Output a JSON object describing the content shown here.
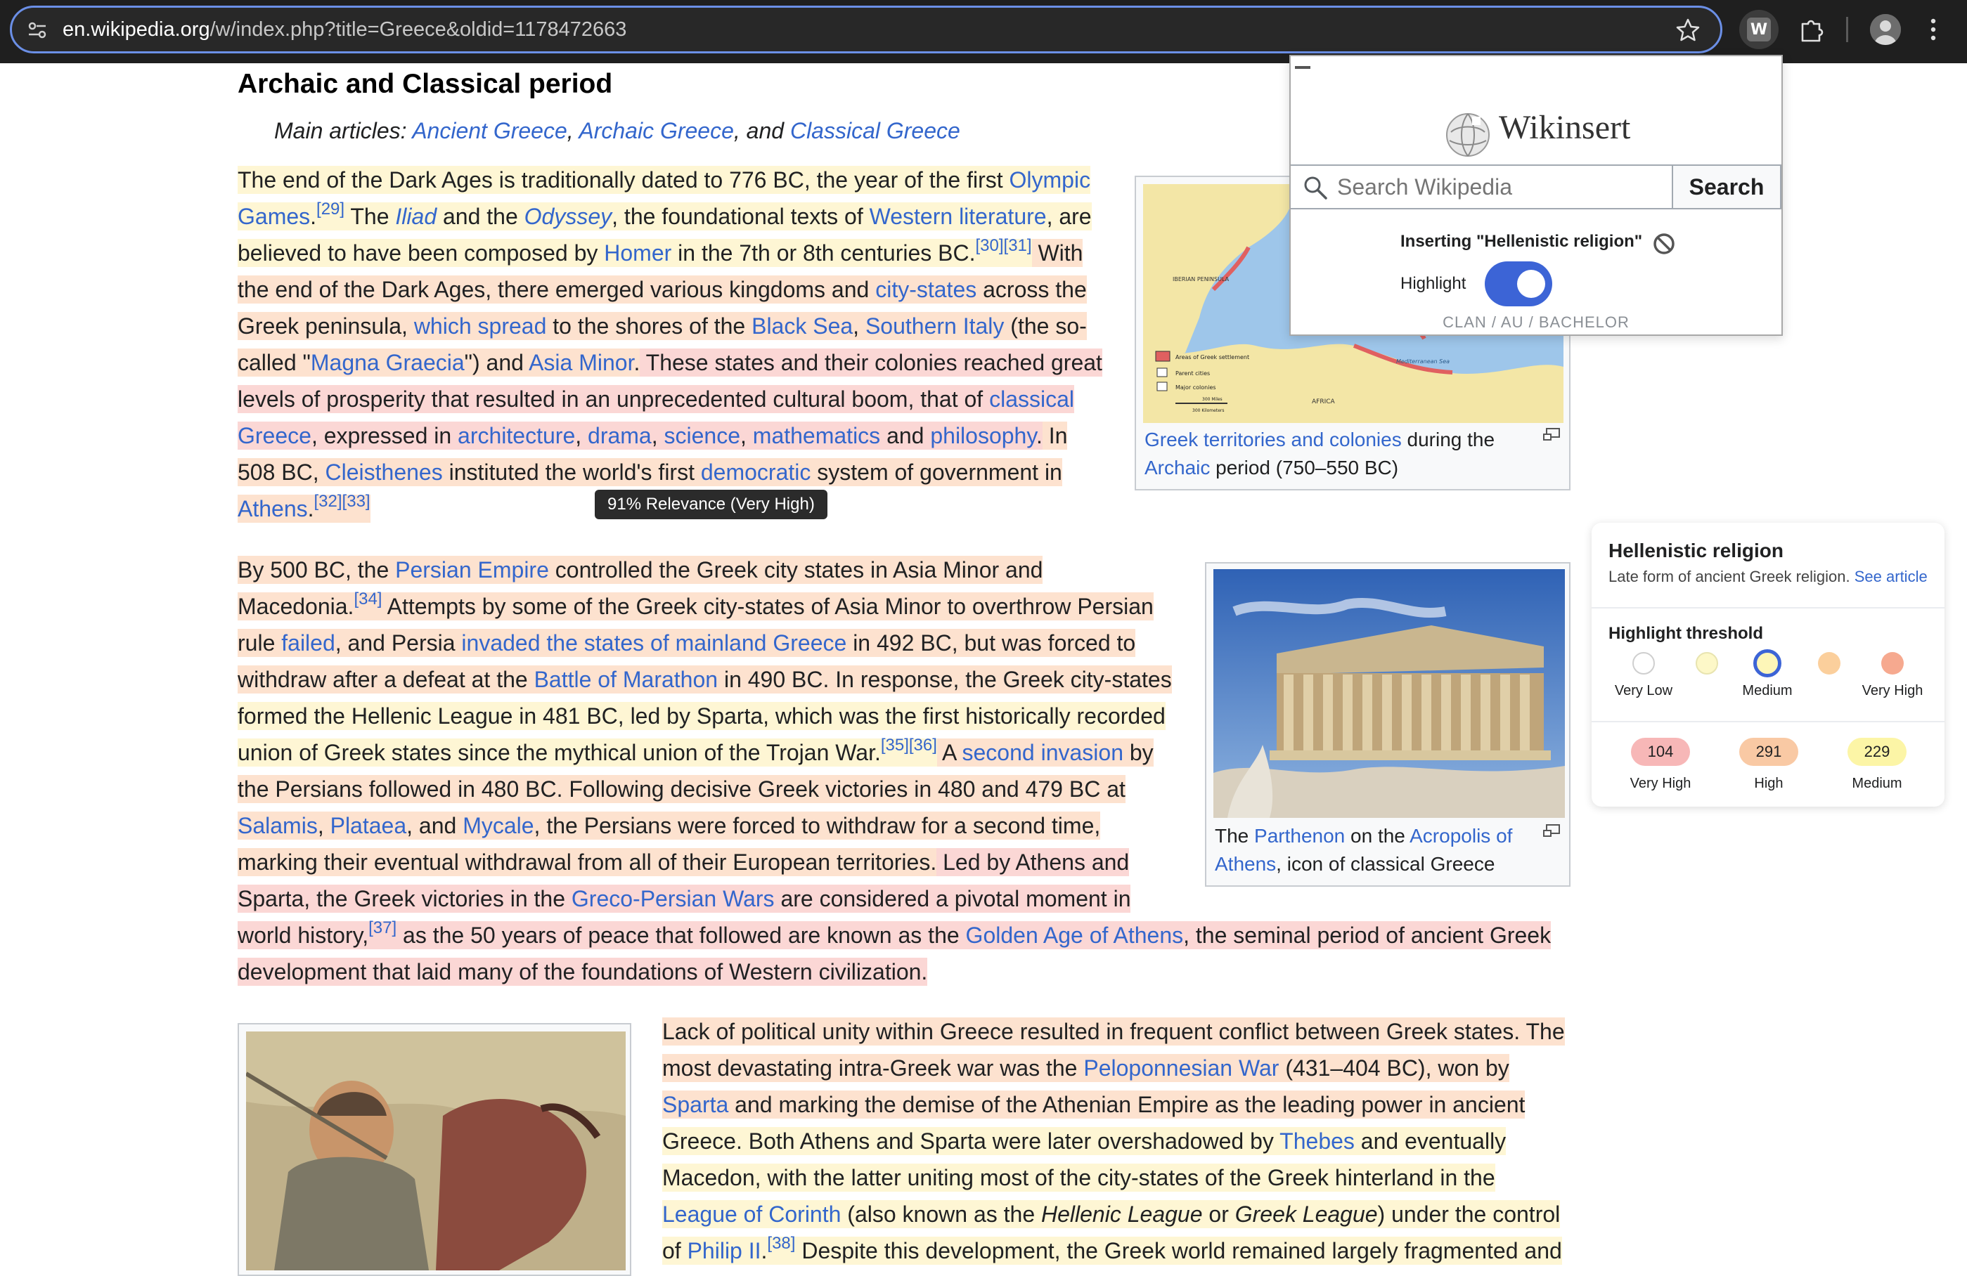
{
  "browser": {
    "url_host": "en.wikipedia.org",
    "url_path": "/w/index.php?title=Greece&oldid=1178472663",
    "extension_letter": "W"
  },
  "article": {
    "heading": "Archaic and Classical period",
    "hatnote": {
      "prefix": "Main articles: ",
      "links": [
        "Ancient Greece",
        "Archaic Greece",
        "Classical Greece"
      ],
      "sep1": ", ",
      "sep2": ", and "
    },
    "tooltip": "91% Relevance (Very High)",
    "fig1": {
      "caption_link1": "Greek territories and colonies",
      "caption_text1": " during the",
      "caption_link2": "Archaic",
      "caption_text2": " period (750–550 BC)",
      "map_labels": {
        "iberian": "IBERIAN PENINSULA",
        "africa": "AFRICA",
        "sea": "Mediterranean Sea",
        "legend1": "Areas of Greek settlement",
        "legend2": "Parent cities",
        "legend3": "Major colonies",
        "scale1": "300 Miles",
        "scale2": "300 Kilometers"
      }
    },
    "fig2": {
      "caption_text1": "The ",
      "caption_link1": "Parthenon",
      "caption_text2": " on the ",
      "caption_link2": "Acropolis of",
      "caption_link3": "Athens",
      "caption_text3": ", icon of classical Greece"
    }
  },
  "popup": {
    "title": "Wikinsert",
    "search_placeholder": "Search Wikipedia",
    "search_button": "Search",
    "inserting": "Inserting \"Hellenistic religion\"",
    "highlight_label": "Highlight",
    "highlight_on": true,
    "footer": "CLAN / AU / BACHELOR"
  },
  "card": {
    "title": "Hellenistic religion",
    "description": "Late form of ancient Greek religion.",
    "see_article": "See article",
    "threshold_title": "Highlight threshold",
    "levels": [
      {
        "label": "Very Low",
        "color": "#ffffff"
      },
      {
        "label": "",
        "color": "#fdf8c8"
      },
      {
        "label": "Medium",
        "color": "#fdf6b8",
        "selected": true
      },
      {
        "label": "",
        "color": "#fbcf9c"
      },
      {
        "label": "Very High",
        "color": "#f6a98f"
      }
    ],
    "counts": [
      {
        "value": "104",
        "label": "Very High",
        "color": "#f7b7b7"
      },
      {
        "value": "291",
        "label": "High",
        "color": "#f9c9a4"
      },
      {
        "value": "229",
        "label": "Medium",
        "color": "#fcf5a6"
      }
    ]
  },
  "colors": {
    "link": "#3366cc",
    "highlight_very_high": "#fbd7d5",
    "highlight_high": "#fde2cf",
    "highlight_medium": "#fef6d4",
    "toggle": "#3c64d6"
  }
}
